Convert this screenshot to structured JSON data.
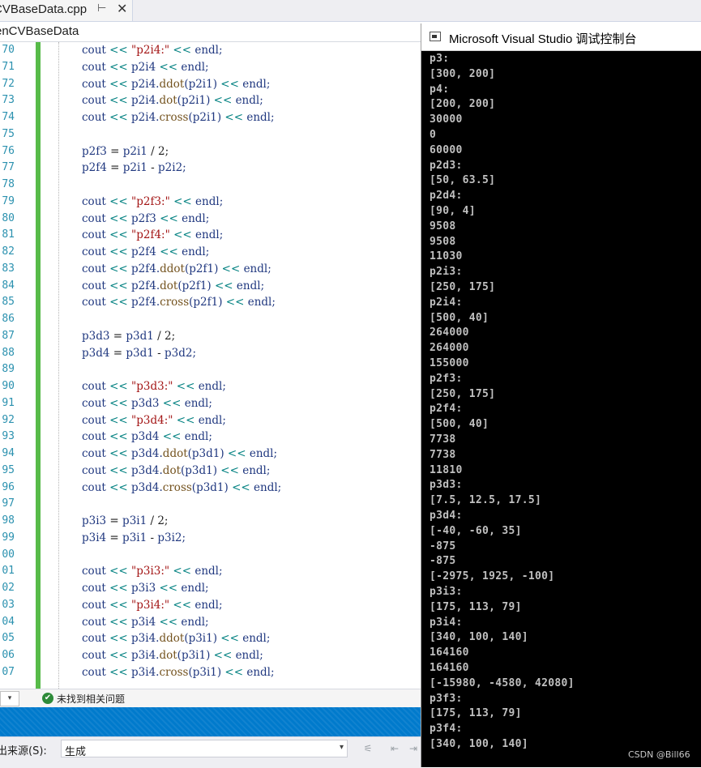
{
  "tab": {
    "title": "CVBaseData.cpp",
    "pin_glyph": "⊢",
    "close_glyph": "✕"
  },
  "navbar": {
    "scope": "enCVBaseData"
  },
  "editor": {
    "lines": [
      {
        "num": "70",
        "tokens": [
          [
            "cout",
            "v"
          ],
          [
            " << ",
            "o"
          ],
          [
            "\"p2i4:\"",
            "s"
          ],
          [
            " << ",
            "o"
          ],
          [
            "endl;",
            "v"
          ]
        ]
      },
      {
        "num": "71",
        "tokens": [
          [
            "cout",
            "v"
          ],
          [
            " << ",
            "o"
          ],
          [
            "p2i4",
            "v"
          ],
          [
            " << ",
            "o"
          ],
          [
            "endl;",
            "v"
          ]
        ]
      },
      {
        "num": "72",
        "tokens": [
          [
            "cout",
            "v"
          ],
          [
            " << ",
            "o"
          ],
          [
            "p2i4.",
            "v"
          ],
          [
            "ddot",
            "f"
          ],
          [
            "(p2i1)",
            "v"
          ],
          [
            " << ",
            "o"
          ],
          [
            "endl;",
            "v"
          ]
        ]
      },
      {
        "num": "73",
        "tokens": [
          [
            "cout",
            "v"
          ],
          [
            " << ",
            "o"
          ],
          [
            "p2i4.",
            "v"
          ],
          [
            "dot",
            "f"
          ],
          [
            "(p2i1)",
            "v"
          ],
          [
            " << ",
            "o"
          ],
          [
            "endl;",
            "v"
          ]
        ]
      },
      {
        "num": "74",
        "tokens": [
          [
            "cout",
            "v"
          ],
          [
            " << ",
            "o"
          ],
          [
            "p2i4.",
            "v"
          ],
          [
            "cross",
            "f"
          ],
          [
            "(p2i1)",
            "v"
          ],
          [
            " << ",
            "o"
          ],
          [
            "endl;",
            "v"
          ]
        ]
      },
      {
        "num": "75",
        "tokens": []
      },
      {
        "num": "76",
        "tokens": [
          [
            "p2f3",
            "v"
          ],
          [
            " = ",
            "t"
          ],
          [
            "p2i1",
            "v"
          ],
          [
            " / 2;",
            "t"
          ]
        ]
      },
      {
        "num": "77",
        "tokens": [
          [
            "p2f4",
            "v"
          ],
          [
            " = ",
            "t"
          ],
          [
            "p2i1",
            "v"
          ],
          [
            " - ",
            "t"
          ],
          [
            "p2i2;",
            "v"
          ]
        ]
      },
      {
        "num": "78",
        "tokens": []
      },
      {
        "num": "79",
        "tokens": [
          [
            "cout",
            "v"
          ],
          [
            " << ",
            "o"
          ],
          [
            "\"p2f3:\"",
            "s"
          ],
          [
            " << ",
            "o"
          ],
          [
            "endl;",
            "v"
          ]
        ]
      },
      {
        "num": "80",
        "tokens": [
          [
            "cout",
            "v"
          ],
          [
            " << ",
            "o"
          ],
          [
            "p2f3",
            "v"
          ],
          [
            " << ",
            "o"
          ],
          [
            "endl;",
            "v"
          ]
        ]
      },
      {
        "num": "81",
        "tokens": [
          [
            "cout",
            "v"
          ],
          [
            " << ",
            "o"
          ],
          [
            "\"p2f4:\"",
            "s"
          ],
          [
            " << ",
            "o"
          ],
          [
            "endl;",
            "v"
          ]
        ]
      },
      {
        "num": "82",
        "tokens": [
          [
            "cout",
            "v"
          ],
          [
            " << ",
            "o"
          ],
          [
            "p2f4",
            "v"
          ],
          [
            " << ",
            "o"
          ],
          [
            "endl;",
            "v"
          ]
        ]
      },
      {
        "num": "83",
        "tokens": [
          [
            "cout",
            "v"
          ],
          [
            " << ",
            "o"
          ],
          [
            "p2f4.",
            "v"
          ],
          [
            "ddot",
            "f"
          ],
          [
            "(p2f1)",
            "v"
          ],
          [
            " << ",
            "o"
          ],
          [
            "endl;",
            "v"
          ]
        ]
      },
      {
        "num": "84",
        "tokens": [
          [
            "cout",
            "v"
          ],
          [
            " << ",
            "o"
          ],
          [
            "p2f4.",
            "v"
          ],
          [
            "dot",
            "f"
          ],
          [
            "(p2f1)",
            "v"
          ],
          [
            " << ",
            "o"
          ],
          [
            "endl;",
            "v"
          ]
        ]
      },
      {
        "num": "85",
        "tokens": [
          [
            "cout",
            "v"
          ],
          [
            " << ",
            "o"
          ],
          [
            "p2f4.",
            "v"
          ],
          [
            "cross",
            "f"
          ],
          [
            "(p2f1)",
            "v"
          ],
          [
            " << ",
            "o"
          ],
          [
            "endl;",
            "v"
          ]
        ]
      },
      {
        "num": "86",
        "tokens": []
      },
      {
        "num": "87",
        "tokens": [
          [
            "p3d3",
            "v"
          ],
          [
            " = ",
            "t"
          ],
          [
            "p3d1",
            "v"
          ],
          [
            " / 2;",
            "t"
          ]
        ]
      },
      {
        "num": "88",
        "tokens": [
          [
            "p3d4",
            "v"
          ],
          [
            " = ",
            "t"
          ],
          [
            "p3d1",
            "v"
          ],
          [
            " - ",
            "t"
          ],
          [
            "p3d2;",
            "v"
          ]
        ]
      },
      {
        "num": "89",
        "tokens": []
      },
      {
        "num": "90",
        "tokens": [
          [
            "cout",
            "v"
          ],
          [
            " << ",
            "o"
          ],
          [
            "\"p3d3:\"",
            "s"
          ],
          [
            " << ",
            "o"
          ],
          [
            "endl;",
            "v"
          ]
        ]
      },
      {
        "num": "91",
        "tokens": [
          [
            "cout",
            "v"
          ],
          [
            " << ",
            "o"
          ],
          [
            "p3d3",
            "v"
          ],
          [
            " << ",
            "o"
          ],
          [
            "endl;",
            "v"
          ]
        ]
      },
      {
        "num": "92",
        "tokens": [
          [
            "cout",
            "v"
          ],
          [
            " << ",
            "o"
          ],
          [
            "\"p3d4:\"",
            "s"
          ],
          [
            " << ",
            "o"
          ],
          [
            "endl;",
            "v"
          ]
        ]
      },
      {
        "num": "93",
        "tokens": [
          [
            "cout",
            "v"
          ],
          [
            " << ",
            "o"
          ],
          [
            "p3d4",
            "v"
          ],
          [
            " << ",
            "o"
          ],
          [
            "endl;",
            "v"
          ]
        ]
      },
      {
        "num": "94",
        "tokens": [
          [
            "cout",
            "v"
          ],
          [
            " << ",
            "o"
          ],
          [
            "p3d4.",
            "v"
          ],
          [
            "ddot",
            "f"
          ],
          [
            "(p3d1)",
            "v"
          ],
          [
            " << ",
            "o"
          ],
          [
            "endl;",
            "v"
          ]
        ]
      },
      {
        "num": "95",
        "tokens": [
          [
            "cout",
            "v"
          ],
          [
            " << ",
            "o"
          ],
          [
            "p3d4.",
            "v"
          ],
          [
            "dot",
            "f"
          ],
          [
            "(p3d1)",
            "v"
          ],
          [
            " << ",
            "o"
          ],
          [
            "endl;",
            "v"
          ]
        ]
      },
      {
        "num": "96",
        "tokens": [
          [
            "cout",
            "v"
          ],
          [
            " << ",
            "o"
          ],
          [
            "p3d4.",
            "v"
          ],
          [
            "cross",
            "f"
          ],
          [
            "(p3d1)",
            "v"
          ],
          [
            " << ",
            "o"
          ],
          [
            "endl;",
            "v"
          ]
        ]
      },
      {
        "num": "97",
        "tokens": []
      },
      {
        "num": "98",
        "tokens": [
          [
            "p3i3",
            "v"
          ],
          [
            " = ",
            "t"
          ],
          [
            "p3i1",
            "v"
          ],
          [
            " / 2;",
            "t"
          ]
        ]
      },
      {
        "num": "99",
        "tokens": [
          [
            "p3i4",
            "v"
          ],
          [
            " = ",
            "t"
          ],
          [
            "p3i1",
            "v"
          ],
          [
            " - ",
            "t"
          ],
          [
            "p3i2;",
            "v"
          ]
        ]
      },
      {
        "num": "00",
        "tokens": []
      },
      {
        "num": "01",
        "tokens": [
          [
            "cout",
            "v"
          ],
          [
            " << ",
            "o"
          ],
          [
            "\"p3i3:\"",
            "s"
          ],
          [
            " << ",
            "o"
          ],
          [
            "endl;",
            "v"
          ]
        ]
      },
      {
        "num": "02",
        "tokens": [
          [
            "cout",
            "v"
          ],
          [
            " << ",
            "o"
          ],
          [
            "p3i3",
            "v"
          ],
          [
            " << ",
            "o"
          ],
          [
            "endl;",
            "v"
          ]
        ]
      },
      {
        "num": "03",
        "tokens": [
          [
            "cout",
            "v"
          ],
          [
            " << ",
            "o"
          ],
          [
            "\"p3i4:\"",
            "s"
          ],
          [
            " << ",
            "o"
          ],
          [
            "endl;",
            "v"
          ]
        ]
      },
      {
        "num": "04",
        "tokens": [
          [
            "cout",
            "v"
          ],
          [
            " << ",
            "o"
          ],
          [
            "p3i4",
            "v"
          ],
          [
            " << ",
            "o"
          ],
          [
            "endl;",
            "v"
          ]
        ]
      },
      {
        "num": "05",
        "tokens": [
          [
            "cout",
            "v"
          ],
          [
            " << ",
            "o"
          ],
          [
            "p3i4.",
            "v"
          ],
          [
            "ddot",
            "f"
          ],
          [
            "(p3i1)",
            "v"
          ],
          [
            " << ",
            "o"
          ],
          [
            "endl;",
            "v"
          ]
        ]
      },
      {
        "num": "06",
        "tokens": [
          [
            "cout",
            "v"
          ],
          [
            " << ",
            "o"
          ],
          [
            "p3i4.",
            "v"
          ],
          [
            "dot",
            "f"
          ],
          [
            "(p3i1)",
            "v"
          ],
          [
            " << ",
            "o"
          ],
          [
            "endl;",
            "v"
          ]
        ]
      },
      {
        "num": "07",
        "tokens": [
          [
            "cout",
            "v"
          ],
          [
            " << ",
            "o"
          ],
          [
            "p3i4.",
            "v"
          ],
          [
            "cross",
            "f"
          ],
          [
            "(p3i1)",
            "v"
          ],
          [
            " << ",
            "o"
          ],
          [
            "endl;",
            "v"
          ]
        ]
      }
    ],
    "colors": {
      "operator": "#008080",
      "string": "#a31515",
      "variable": "#1f377f",
      "function": "#74531f",
      "line_number": "#2b91af",
      "change_bar": "#57bb49"
    }
  },
  "status": {
    "zoom_glyph": "▾",
    "ok_icon": "check-circle-icon",
    "ok_glyph": "✔",
    "message": "未找到相关问题"
  },
  "output": {
    "label": "出来源(S):",
    "source_value": "生成",
    "dropdown_glyph": "▾"
  },
  "console": {
    "title": "Microsoft Visual Studio 调试控制台",
    "lines": [
      "p3:",
      "[300, 200]",
      "p4:",
      "[200, 200]",
      "30000",
      "0",
      "60000",
      "p2d3:",
      "[50, 63.5]",
      "p2d4:",
      "[90, 4]",
      "9508",
      "9508",
      "11030",
      "p2i3:",
      "[250, 175]",
      "p2i4:",
      "[500, 40]",
      "264000",
      "264000",
      "155000",
      "p2f3:",
      "[250, 175]",
      "p2f4:",
      "[500, 40]",
      "7738",
      "7738",
      "11810",
      "p3d3:",
      "[7.5, 12.5, 17.5]",
      "p3d4:",
      "[-40, -60, 35]",
      "-875",
      "-875",
      "[-2975, 1925, -100]",
      "p3i3:",
      "[175, 113, 79]",
      "p3i4:",
      "[340, 100, 140]",
      "164160",
      "164160",
      "[-15980, -4580, 42080]",
      "p3f3:",
      "[175, 113, 79]",
      "p3f4:",
      "[340, 100, 140]"
    ]
  },
  "watermark": "CSDN @Bill66"
}
